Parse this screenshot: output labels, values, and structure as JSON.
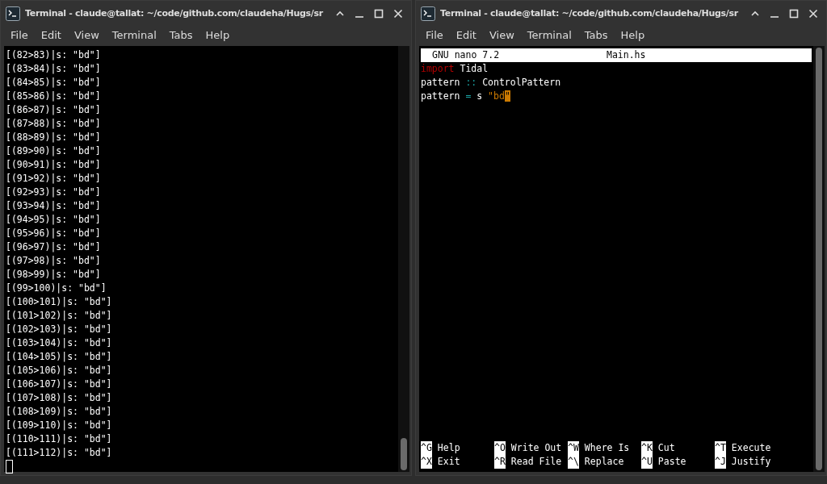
{
  "windows": [
    {
      "title": "Terminal - claude@tallat: ~/code/github.com/claudeha/Hugs/sr",
      "menu": [
        "File",
        "Edit",
        "View",
        "Terminal",
        "Tabs",
        "Help"
      ],
      "kind": "shell",
      "lines": [
        "[(82>83)|s: \"bd\"]",
        "[(83>84)|s: \"bd\"]",
        "[(84>85)|s: \"bd\"]",
        "[(85>86)|s: \"bd\"]",
        "[(86>87)|s: \"bd\"]",
        "[(87>88)|s: \"bd\"]",
        "[(88>89)|s: \"bd\"]",
        "[(89>90)|s: \"bd\"]",
        "[(90>91)|s: \"bd\"]",
        "[(91>92)|s: \"bd\"]",
        "[(92>93)|s: \"bd\"]",
        "[(93>94)|s: \"bd\"]",
        "[(94>95)|s: \"bd\"]",
        "[(95>96)|s: \"bd\"]",
        "[(96>97)|s: \"bd\"]",
        "[(97>98)|s: \"bd\"]",
        "[(98>99)|s: \"bd\"]",
        "[(99>100)|s: \"bd\"]",
        "[(100>101)|s: \"bd\"]",
        "[(101>102)|s: \"bd\"]",
        "[(102>103)|s: \"bd\"]",
        "[(103>104)|s: \"bd\"]",
        "[(104>105)|s: \"bd\"]",
        "[(105>106)|s: \"bd\"]",
        "[(106>107)|s: \"bd\"]",
        "[(107>108)|s: \"bd\"]",
        "[(108>109)|s: \"bd\"]",
        "[(109>110)|s: \"bd\"]",
        "[(110>111)|s: \"bd\"]",
        "[(111>112)|s: \"bd\"]"
      ]
    },
    {
      "title": "Terminal - claude@tallat: ~/code/github.com/claudeha/Hugs/sr",
      "menu": [
        "File",
        "Edit",
        "View",
        "Terminal",
        "Tabs",
        "Help"
      ],
      "kind": "nano",
      "nano": {
        "version": "GNU nano 7.2",
        "filename": "Main.hs",
        "code": [
          [
            {
              "kind": "keyword",
              "text": "import"
            },
            {
              "kind": "plain",
              "text": " Tidal"
            }
          ],
          [
            {
              "kind": "plain",
              "text": "pattern "
            },
            {
              "kind": "operator",
              "text": "::"
            },
            {
              "kind": "plain",
              "text": " ControlPattern"
            }
          ],
          [
            {
              "kind": "plain",
              "text": "pattern "
            },
            {
              "kind": "operator",
              "text": "="
            },
            {
              "kind": "plain",
              "text": " s "
            },
            {
              "kind": "string",
              "text": "\"bd"
            },
            {
              "kind": "cursor",
              "text": "\""
            }
          ]
        ],
        "shortcuts": [
          [
            {
              "key": "^G",
              "label": "Help"
            },
            {
              "key": "^X",
              "label": "Exit"
            }
          ],
          [
            {
              "key": "^O",
              "label": "Write Out"
            },
            {
              "key": "^R",
              "label": "Read File"
            }
          ],
          [
            {
              "key": "^W",
              "label": "Where Is"
            },
            {
              "key": "^\\",
              "label": "Replace"
            }
          ],
          [
            {
              "key": "^K",
              "label": "Cut"
            },
            {
              "key": "^U",
              "label": "Paste"
            }
          ],
          [
            {
              "key": "^T",
              "label": "Execute"
            },
            {
              "key": "^J",
              "label": "Justify"
            }
          ]
        ]
      }
    }
  ]
}
